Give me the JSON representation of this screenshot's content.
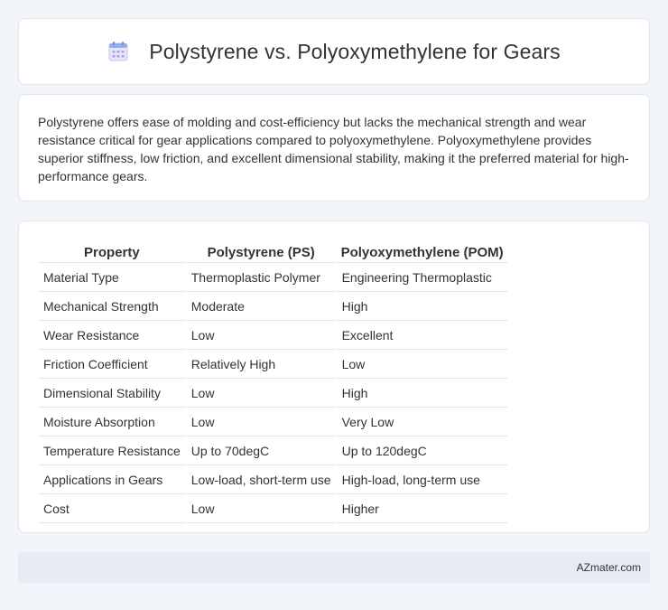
{
  "header": {
    "title": "Polystyrene vs. Polyoxymethylene for Gears",
    "icon": "calendar-icon"
  },
  "intro": {
    "text": "Polystyrene offers ease of molding and cost-efficiency but lacks the mechanical strength and wear resistance critical for gear applications compared to polyoxymethylene. Polyoxymethylene provides superior stiffness, low friction, and excellent dimensional stability, making it the preferred material for high-performance gears."
  },
  "table": {
    "headers": [
      "Property",
      "Polystyrene (PS)",
      "Polyoxymethylene (POM)"
    ],
    "rows": [
      [
        "Material Type",
        "Thermoplastic Polymer",
        "Engineering Thermoplastic"
      ],
      [
        "Mechanical Strength",
        "Moderate",
        "High"
      ],
      [
        "Wear Resistance",
        "Low",
        "Excellent"
      ],
      [
        "Friction Coefficient",
        "Relatively High",
        "Low"
      ],
      [
        "Dimensional Stability",
        "Low",
        "High"
      ],
      [
        "Moisture Absorption",
        "Low",
        "Very Low"
      ],
      [
        "Temperature Resistance",
        "Up to 70degC",
        "Up to 120degC"
      ],
      [
        "Applications in Gears",
        "Low-load, short-term use",
        "High-load, long-term use"
      ],
      [
        "Cost",
        "Low",
        "Higher"
      ]
    ]
  },
  "footer": {
    "text": "AZmater.com"
  }
}
